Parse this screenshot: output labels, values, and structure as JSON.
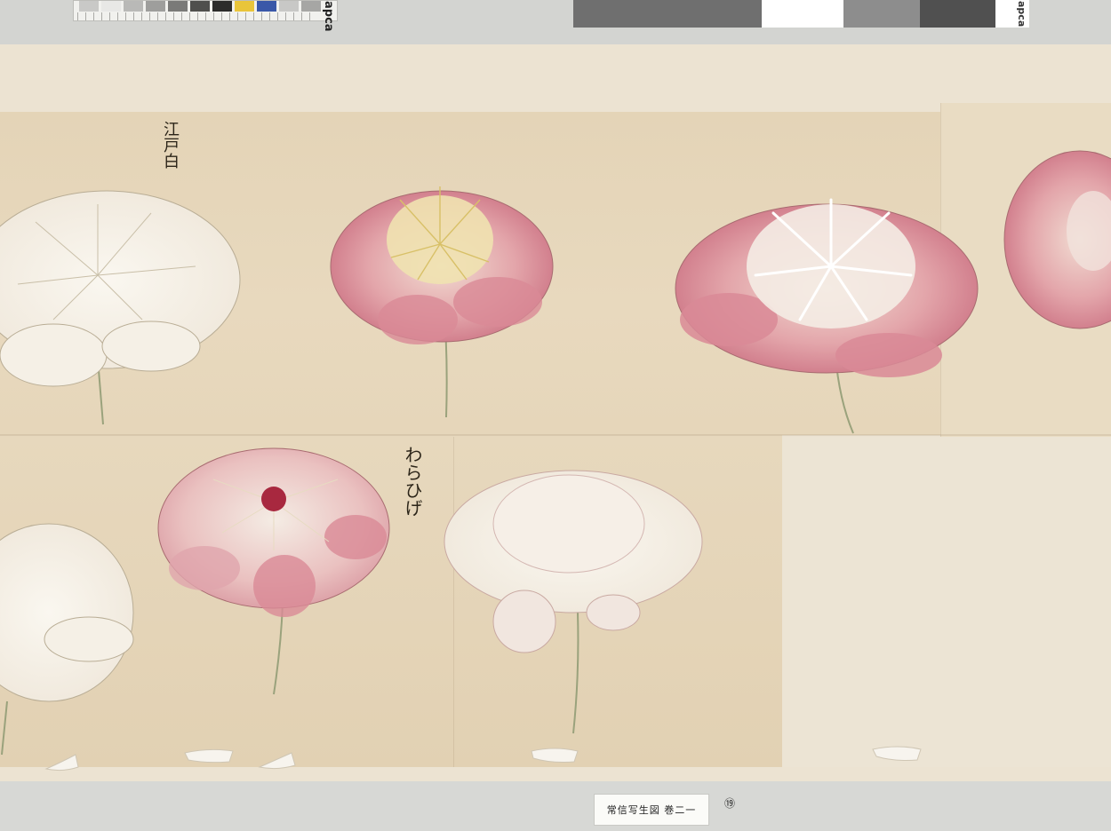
{
  "caption": "常信写生図 巻二一",
  "page_number": "⑲",
  "annotations": {
    "label_top": "江戸白",
    "label_bottom": "わらひげ"
  },
  "calibration": {
    "left_brand": "apca",
    "right_brand": "apca",
    "patch_colors": [
      "#c9c9c7",
      "#e8e8e6",
      "#b9b9b7",
      "#9e9e9c",
      "#7a7a78",
      "#4f4f4d",
      "#2c2c2b",
      "#e9c53a",
      "#3a58a8",
      "#c8c8c6",
      "#a6a6a4"
    ],
    "gray_card": [
      "#6f6f6f",
      "#ffffff",
      "#8d8d8d",
      "#505050"
    ]
  },
  "colors": {
    "paper": "#e5d6bc",
    "petal_pink": "#d98a96",
    "petal_deep": "#c25f74",
    "petal_white": "#f4efe6",
    "stamen_yellow": "#e9d88a",
    "stem": "#9aa27c"
  }
}
